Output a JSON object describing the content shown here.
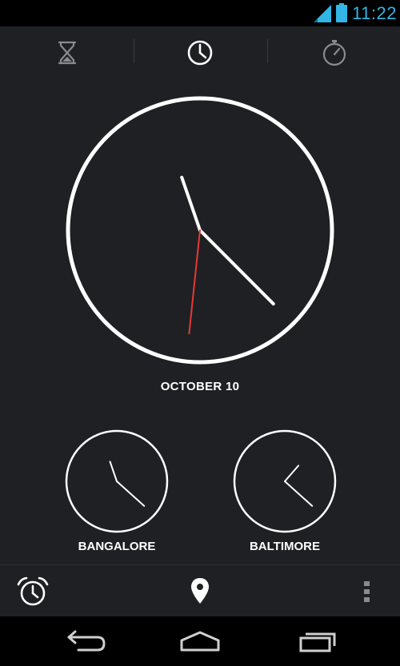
{
  "status_bar": {
    "time": "11:22",
    "signal_icon": "signal-icon",
    "battery_icon": "battery-icon",
    "accent_color": "#33b5e5"
  },
  "tabs": [
    {
      "name": "timer",
      "icon": "hourglass-icon",
      "selected": false
    },
    {
      "name": "clock",
      "icon": "clock-icon",
      "selected": true
    },
    {
      "name": "stopwatch",
      "icon": "stopwatch-icon",
      "selected": false
    }
  ],
  "main_clock": {
    "date": "OCTOBER 10",
    "time": {
      "hour": 11,
      "minute": 22,
      "second": 31
    },
    "second_hand_color": "#e53935"
  },
  "world_clocks": [
    {
      "city": "BANGALORE",
      "time": {
        "hour": 11,
        "minute": 22
      }
    },
    {
      "city": "BALTIMORE",
      "time": {
        "hour": 1,
        "minute": 22
      }
    }
  ],
  "action_bar": {
    "alarm_icon": "alarm-clock-icon",
    "cities_icon": "location-pin-icon",
    "overflow_icon": "overflow-menu-icon"
  },
  "nav_bar": {
    "back_icon": "back-icon",
    "home_icon": "home-icon",
    "recents_icon": "recents-icon"
  }
}
